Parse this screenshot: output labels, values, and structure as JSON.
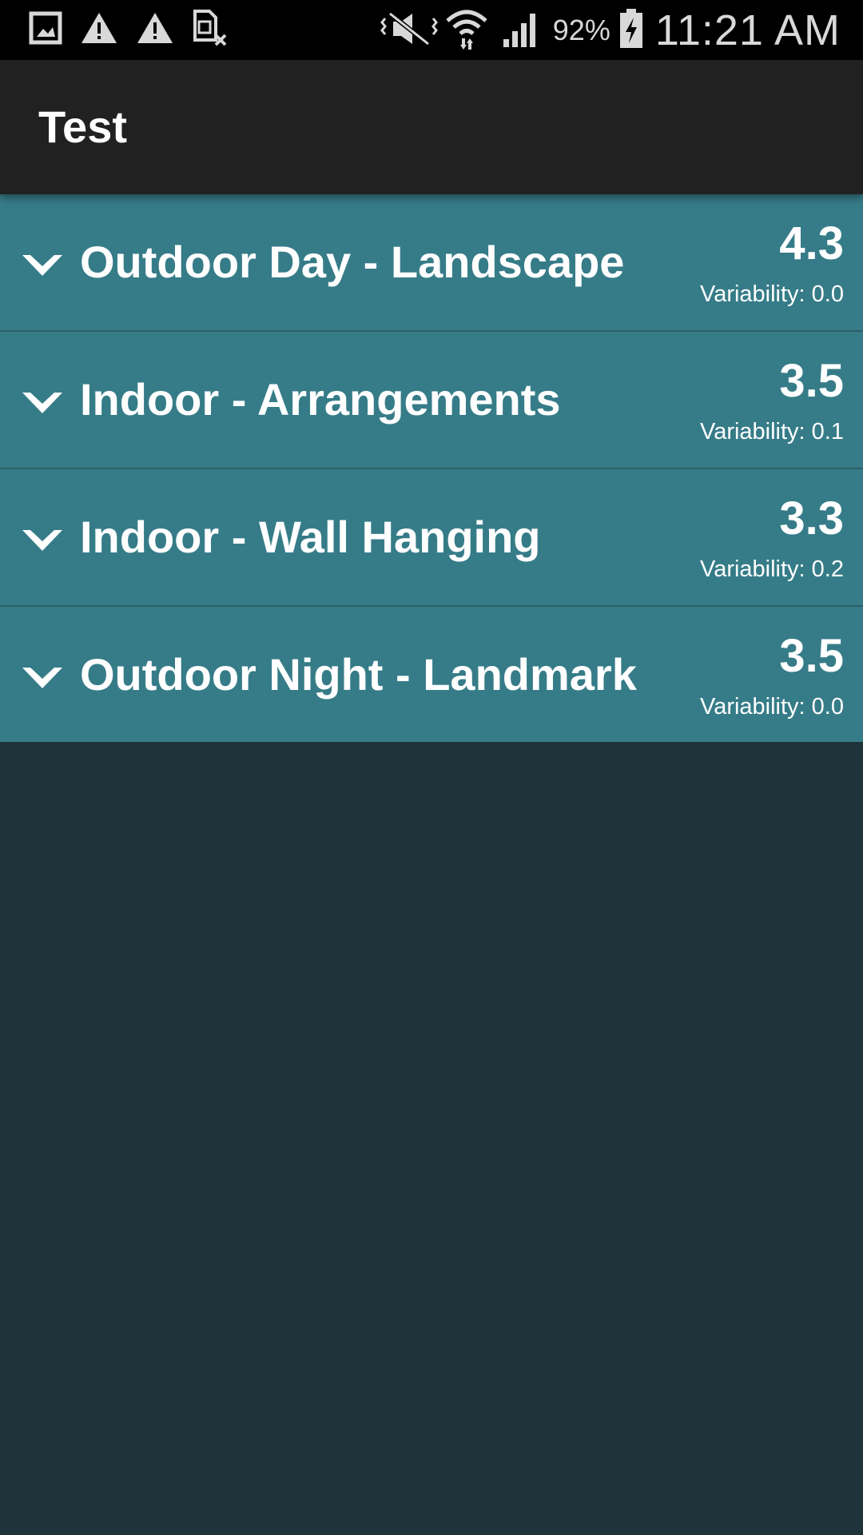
{
  "status_bar": {
    "icons_left": [
      "gallery-icon",
      "warning-icon",
      "warning-icon",
      "no-sim-icon"
    ],
    "icons_right": [
      "vibrate-mute-icon",
      "wifi-icon",
      "signal-icon"
    ],
    "battery_percent": "92%",
    "time": "11:21 AM"
  },
  "app_bar": {
    "title": "Test"
  },
  "list": {
    "items": [
      {
        "title": "Outdoor Day - Landscape",
        "score": "4.3",
        "variability": "Variability: 0.0"
      },
      {
        "title": "Indoor - Arrangements",
        "score": "3.5",
        "variability": "Variability: 0.1"
      },
      {
        "title": "Indoor - Wall Hanging",
        "score": "3.3",
        "variability": "Variability: 0.2"
      },
      {
        "title": "Outdoor Night - Landmark",
        "score": "3.5",
        "variability": "Variability: 0.0"
      }
    ]
  },
  "colors": {
    "row_background": "#367c88",
    "page_background": "#1e343a",
    "app_bar": "#212121",
    "status_bar": "#000000"
  }
}
